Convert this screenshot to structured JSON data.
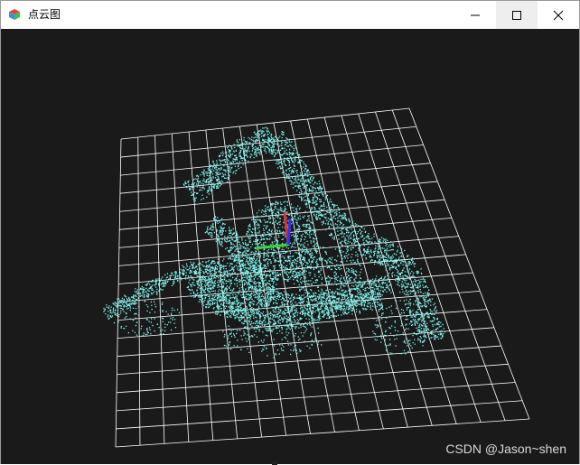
{
  "window": {
    "title": "点云图",
    "controls": {
      "minimize": "minimize-icon",
      "maximize": "maximize-icon",
      "close": "close-icon"
    }
  },
  "viewport": {
    "background": "#1a1a1a",
    "grid_color": "#ffffff",
    "point_color": "#7ff5ef",
    "axes": {
      "x_color": "#3ad53a",
      "y_color": "#e03030",
      "z_color": "#3030ff"
    }
  },
  "watermark": "CSDN @Jason~shen"
}
